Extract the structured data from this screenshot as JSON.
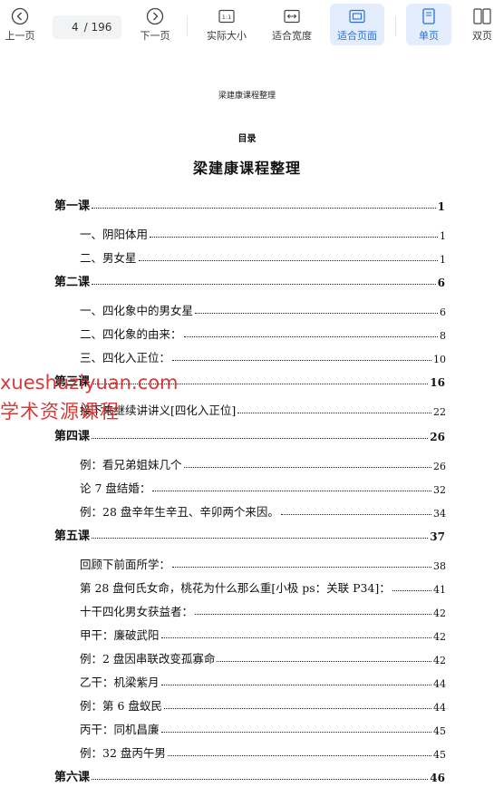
{
  "toolbar": {
    "prev_label": "上一页",
    "current_page": "4",
    "total_pages": "/ 196",
    "next_label": "下一页",
    "actual_size_label": "实际大小",
    "fit_width_label": "适合宽度",
    "fit_page_label": "适合页面",
    "single_page_label": "单页",
    "double_page_label": "双页",
    "active_color": "#2b6fd6"
  },
  "document": {
    "header": "梁建康课程整理",
    "toc_heading": "目录",
    "title": "梁建康课程整理",
    "toc": [
      {
        "text": "第一课",
        "page": "1",
        "level": "chapter"
      },
      {
        "text": "一、阴阳体用",
        "page": "1",
        "level": "section"
      },
      {
        "text": "二、男女星",
        "page": "1",
        "level": "section"
      },
      {
        "text": "第二课",
        "page": "6",
        "level": "chapter"
      },
      {
        "text": "一、四化象中的男女星",
        "page": "6",
        "level": "section"
      },
      {
        "text": "二、四化象的由来：",
        "page": "8",
        "level": "section"
      },
      {
        "text": "三、四化入正位：",
        "page": "10",
        "level": "section"
      },
      {
        "text": "第三课",
        "page": "16",
        "level": "chapter"
      },
      {
        "text": "接下来继续讲讲义[四化入正位]",
        "page": "22",
        "level": "section"
      },
      {
        "text": "第四课",
        "page": "26",
        "level": "chapter"
      },
      {
        "text": "例：看兄弟姐妹几个",
        "page": "26",
        "level": "section"
      },
      {
        "text": "论 7 盘结婚：",
        "page": "32",
        "level": "section"
      },
      {
        "text": "例：28 盘辛年生辛丑、辛卯两个来因。",
        "page": "34",
        "level": "section"
      },
      {
        "text": "第五课",
        "page": "37",
        "level": "chapter"
      },
      {
        "text": "回顾下前面所学：",
        "page": "38",
        "level": "section"
      },
      {
        "text": "第 28 盘何氏女命，桃花为什么那么重[小极 ps：关联 P34]：",
        "page": "41",
        "level": "section"
      },
      {
        "text": "十干四化男女获益者：",
        "page": "42",
        "level": "section"
      },
      {
        "text": "甲干：廉破武阳",
        "page": "42",
        "level": "section"
      },
      {
        "text": "例：2 盘因串联改变孤寡命",
        "page": "42",
        "level": "section"
      },
      {
        "text": "乙干：机梁紫月",
        "page": "44",
        "level": "section"
      },
      {
        "text": "例：第 6 盘蚁民",
        "page": "44",
        "level": "section"
      },
      {
        "text": "丙干：同机昌廉",
        "page": "45",
        "level": "section"
      },
      {
        "text": "例：32 盘丙午男",
        "page": "45",
        "level": "section"
      },
      {
        "text": "第六课",
        "page": "46",
        "level": "chapter"
      }
    ]
  },
  "watermark": {
    "line1": "xueshuziyuan.com",
    "line2": "学术资源课程",
    "color": "#d12b2b"
  }
}
